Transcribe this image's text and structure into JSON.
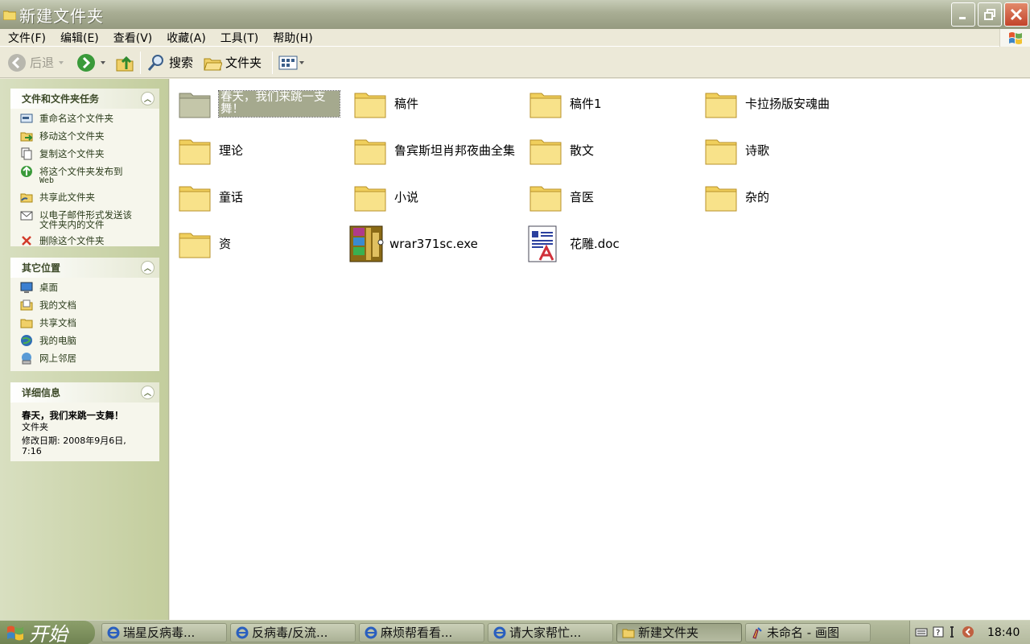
{
  "window": {
    "title": "新建文件夹"
  },
  "menu": [
    "文件(F)",
    "编辑(E)",
    "查看(V)",
    "收藏(A)",
    "工具(T)",
    "帮助(H)"
  ],
  "toolbar": {
    "back": "后退",
    "search": "搜索",
    "folders": "文件夹"
  },
  "tasks_panel": {
    "title": "文件和文件夹任务",
    "items": [
      {
        "label": "重命名这个文件夹",
        "icon": "rename-icon"
      },
      {
        "label": "移动这个文件夹",
        "icon": "move-icon"
      },
      {
        "label": "复制这个文件夹",
        "icon": "copy-icon"
      },
      {
        "label": "将这个文件夹发布到",
        "sub": "Web",
        "icon": "publish-web-icon"
      },
      {
        "label": "共享此文件夹",
        "icon": "share-icon"
      },
      {
        "label": "以电子邮件形式发送该",
        "sub": "文件夹内的文件",
        "icon": "email-icon"
      },
      {
        "label": "删除这个文件夹",
        "icon": "delete-icon"
      }
    ]
  },
  "places_panel": {
    "title": "其它位置",
    "items": [
      {
        "label": "桌面",
        "icon": "desktop-icon"
      },
      {
        "label": "我的文档",
        "icon": "my-documents-icon"
      },
      {
        "label": "共享文档",
        "icon": "shared-documents-icon"
      },
      {
        "label": "我的电脑",
        "icon": "my-computer-icon"
      },
      {
        "label": "网上邻居",
        "icon": "network-places-icon"
      }
    ]
  },
  "details_panel": {
    "title": "详细信息",
    "name": "春天，我们来跳一支舞！",
    "type": "文件夹",
    "modified_label": "修改日期: 2008年9月6日,",
    "modified_time": "7:16"
  },
  "files": [
    {
      "name": "春天，我们来跳一支舞！",
      "type": "folder",
      "selected": true
    },
    {
      "name": "稿件",
      "type": "folder"
    },
    {
      "name": "稿件1",
      "type": "folder"
    },
    {
      "name": "卡拉扬版安魂曲",
      "type": "folder"
    },
    {
      "name": "理论",
      "type": "folder"
    },
    {
      "name": "鲁宾斯坦肖邦夜曲全集",
      "type": "folder"
    },
    {
      "name": "散文",
      "type": "folder"
    },
    {
      "name": "诗歌",
      "type": "folder"
    },
    {
      "name": "童话",
      "type": "folder"
    },
    {
      "name": "小说",
      "type": "folder"
    },
    {
      "name": "音医",
      "type": "folder"
    },
    {
      "name": "杂的",
      "type": "folder"
    },
    {
      "name": "资",
      "type": "folder"
    },
    {
      "name": "wrar371sc.exe",
      "type": "winrar-exe"
    },
    {
      "name": "花雕.doc",
      "type": "word-doc"
    }
  ],
  "taskbar": {
    "start": "开始",
    "buttons": [
      {
        "label": "瑞星反病毒...",
        "icon": "ie-icon"
      },
      {
        "label": "反病毒/反流...",
        "icon": "ie-icon"
      },
      {
        "label": "麻烦帮看看...",
        "icon": "ie-icon"
      },
      {
        "label": "请大家帮忙...",
        "icon": "ie-icon"
      },
      {
        "label": "新建文件夹",
        "icon": "folder-icon",
        "active": true
      },
      {
        "label": "未命名 - 画图",
        "icon": "paint-icon"
      }
    ],
    "clock": "18:40"
  }
}
